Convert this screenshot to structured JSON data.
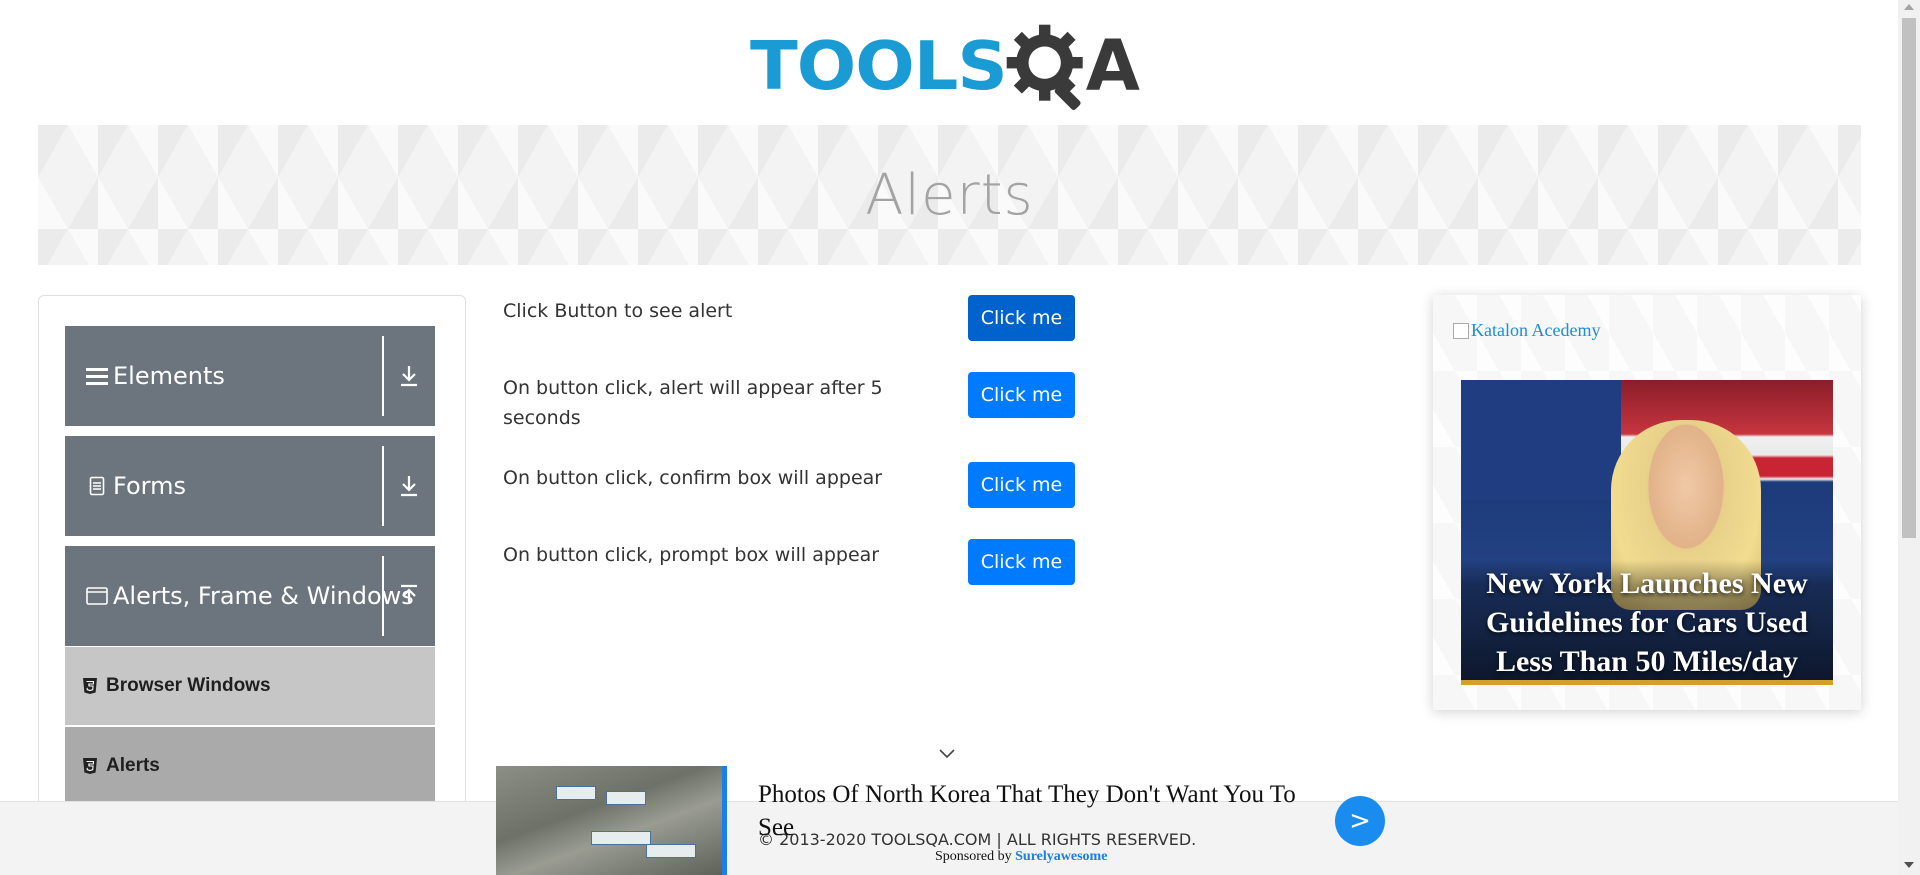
{
  "header": {
    "logo_left": "TOOLS",
    "logo_right": "A"
  },
  "banner": {
    "title": "Alerts"
  },
  "sidebar": {
    "groups": [
      {
        "label": "Elements",
        "icon": "hamburger-icon",
        "arrow": "download-arrow-icon"
      },
      {
        "label": "Forms",
        "icon": "document-icon",
        "arrow": "download-arrow-icon"
      },
      {
        "label": "Alerts, Frame & Windows",
        "icon": "window-icon",
        "arrow": "upload-arrow-icon"
      }
    ],
    "items": [
      {
        "label": "Browser Windows",
        "icon": "html5-icon",
        "bg": "#c6c6c6"
      },
      {
        "label": "Alerts",
        "icon": "html5-icon",
        "bg": "#aaaaaa"
      }
    ]
  },
  "alerts": [
    {
      "text": "Click Button to see alert",
      "button": "Click me"
    },
    {
      "text": "On button click, alert will appear after 5",
      "text2": "seconds",
      "button": "Click me"
    },
    {
      "text": "On button click, confirm box will appear",
      "button": "Click me"
    },
    {
      "text": "On button click, prompt box will appear",
      "button": "Click me"
    }
  ],
  "right_ad": {
    "link_text": "Katalon Acedemy",
    "caption": "New York Launches New Guidelines for Cars Used Less Than 50 Miles/day"
  },
  "sticky_ad": {
    "title": "Photos Of North Korea That They Don't Want You To See",
    "go": ">",
    "sponsored_prefix": "Sponsored by",
    "sponsor": "Surelyawesome"
  },
  "footer": {
    "copyright": "© 2013-2020 TOOLSQA.COM | ALL RIGHTS RESERVED."
  },
  "colors": {
    "primary": "#007bff",
    "primary_active": "#0062cc",
    "sidebar_group": "#6c757d",
    "logo_blue": "#1a9bd4",
    "logo_dark": "#3a3a3a"
  }
}
